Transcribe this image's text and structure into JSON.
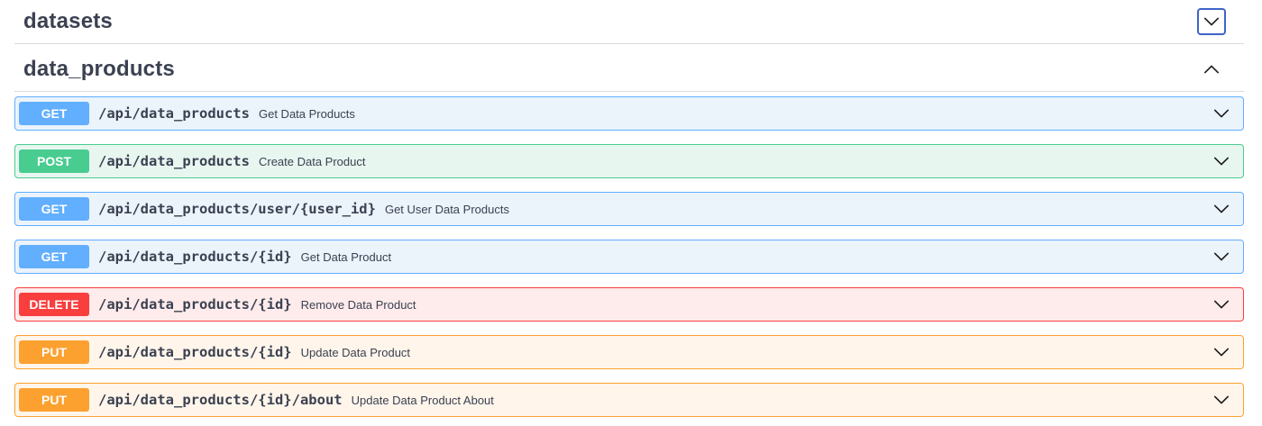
{
  "sections": {
    "datasets": {
      "title": "datasets",
      "expanded": false,
      "toggle_icon": "chevron-down-icon"
    },
    "data_products": {
      "title": "data_products",
      "expanded": true,
      "toggle_icon": "chevron-up-icon"
    }
  },
  "colors": {
    "get": "#61affe",
    "post": "#49cc90",
    "delete": "#f93e3e",
    "put": "#fca130",
    "focus_border": "#3e64c8"
  },
  "operations": [
    {
      "method": "GET",
      "path": "/api/data_products",
      "summary": "Get Data Products"
    },
    {
      "method": "POST",
      "path": "/api/data_products",
      "summary": "Create Data Product"
    },
    {
      "method": "GET",
      "path": "/api/data_products/user/{user_id}",
      "summary": "Get User Data Products"
    },
    {
      "method": "GET",
      "path": "/api/data_products/{id}",
      "summary": "Get Data Product"
    },
    {
      "method": "DELETE",
      "path": "/api/data_products/{id}",
      "summary": "Remove Data Product"
    },
    {
      "method": "PUT",
      "path": "/api/data_products/{id}",
      "summary": "Update Data Product"
    },
    {
      "method": "PUT",
      "path": "/api/data_products/{id}/about",
      "summary": "Update Data Product About"
    }
  ]
}
